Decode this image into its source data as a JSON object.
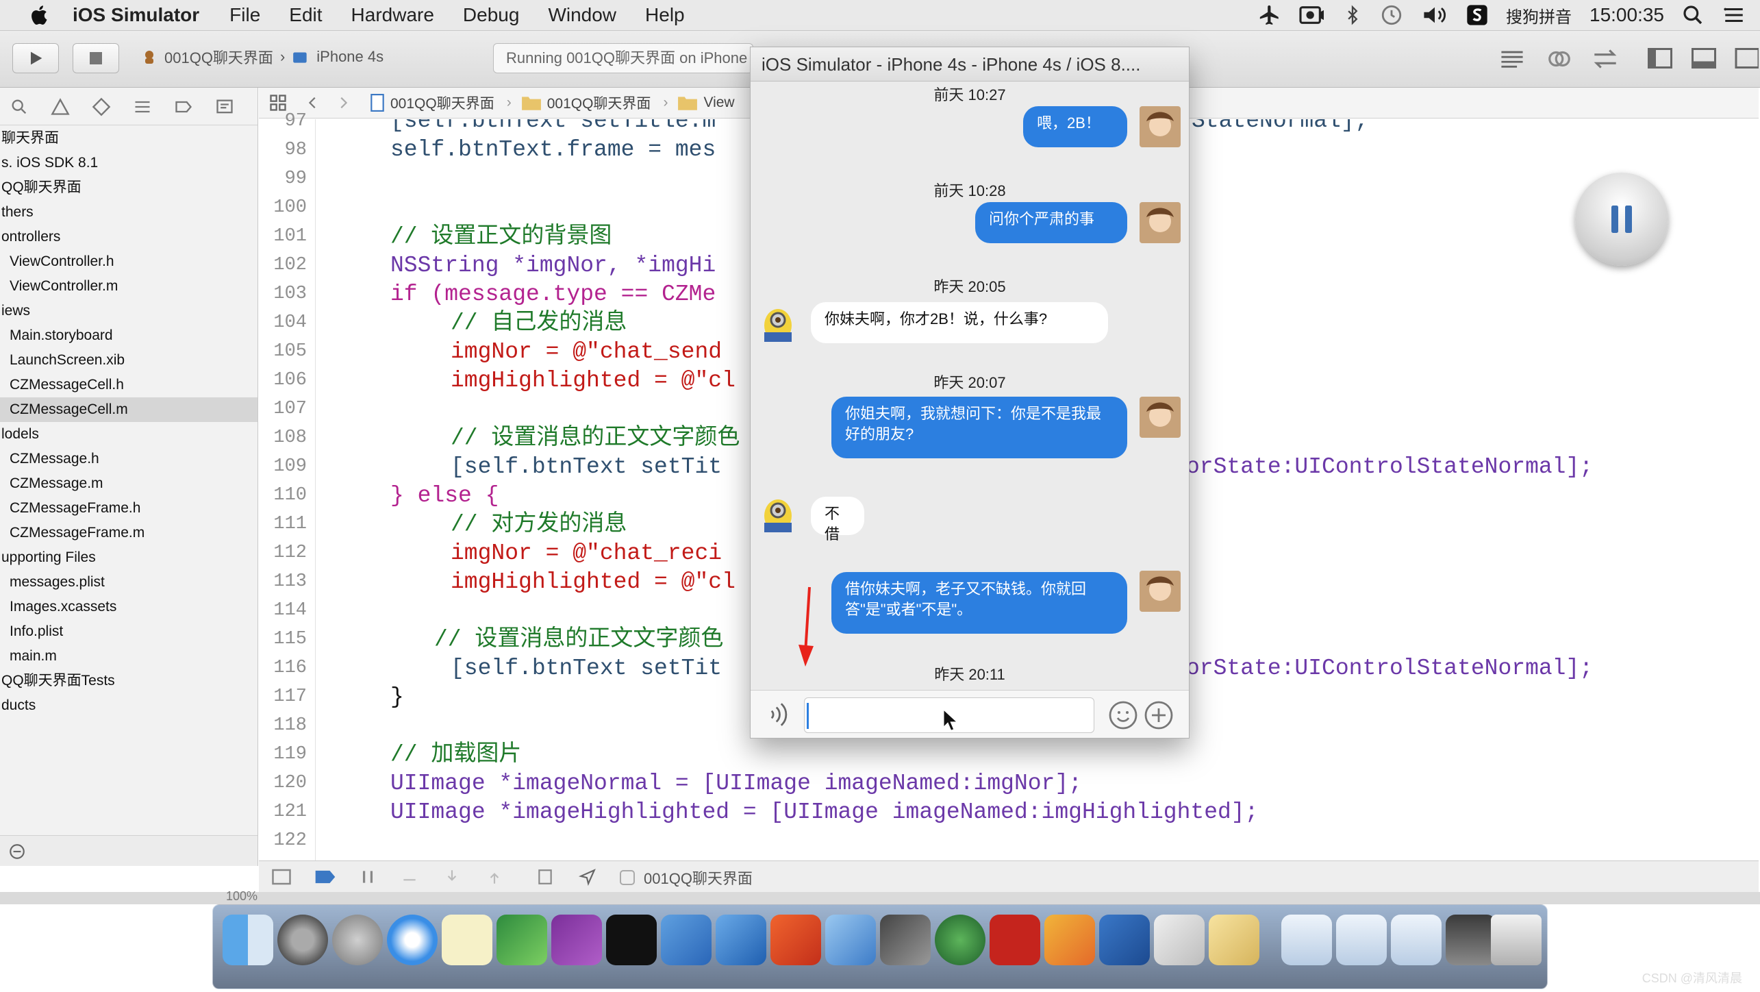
{
  "menubar": {
    "app_name": "iOS Simulator",
    "items": [
      "File",
      "Edit",
      "Hardware",
      "Debug",
      "Window",
      "Help"
    ],
    "ime_label": "搜狗拼音",
    "clock": "15:00:35"
  },
  "toolbar": {
    "scheme_project": "001QQ聊天界面",
    "scheme_device": "iPhone 4s",
    "status": "Running 001QQ聊天界面 on iPhone"
  },
  "jumpbar": {
    "crumbs": [
      "001QQ聊天界面",
      "001QQ聊天界面",
      "View"
    ]
  },
  "navigator": {
    "rows": [
      {
        "label": "聊天界面"
      },
      {
        "label": "s. iOS SDK 8.1"
      },
      {
        "label": "QQ聊天界面"
      },
      {
        "label": "thers"
      },
      {
        "label": "ontrollers"
      },
      {
        "label": "ViewController.h"
      },
      {
        "label": "ViewController.m"
      },
      {
        "label": "iews"
      },
      {
        "label": "Main.storyboard"
      },
      {
        "label": "LaunchScreen.xib"
      },
      {
        "label": "CZMessageCell.h"
      },
      {
        "label": "CZMessageCell.m",
        "selected": true
      },
      {
        "label": "lodels"
      },
      {
        "label": "CZMessage.h"
      },
      {
        "label": "CZMessage.m"
      },
      {
        "label": "CZMessageFrame.h"
      },
      {
        "label": "CZMessageFrame.m"
      },
      {
        "label": "upporting Files"
      },
      {
        "label": "messages.plist"
      },
      {
        "label": "Images.xcassets"
      },
      {
        "label": "Info.plist"
      },
      {
        "label": "main.m"
      },
      {
        "label": "QQ聊天界面Tests"
      },
      {
        "label": "ducts"
      }
    ]
  },
  "editor": {
    "line_numbers": [
      "97",
      "98",
      "99",
      "100",
      "101",
      "102",
      "103",
      "104",
      "105",
      "106",
      "107",
      "108",
      "109",
      "110",
      "111",
      "112",
      "113",
      "114",
      "115",
      "116",
      "117",
      "118",
      "119",
      "120",
      "121",
      "122"
    ],
    "code": {
      "l97a": "[self.btnText setTitle:m",
      "l97b": "StateNormal];",
      "l98": "self.btnText.frame = mes",
      "l101": "// 设置正文的背景图",
      "l102": "NSString *imgNor, *imgHi",
      "l103": "if (message.type == CZMe",
      "l104": "// 自己发的消息",
      "l105": "imgNor = @\"chat_send",
      "l106": "imgHighlighted = @\"cl",
      "l108": "// 设置消息的正文文字颜色",
      "l109a": "[self.btnText setTit",
      "l109b": "orState:UIControlStateNormal];",
      "l110": "} else {",
      "l111": "// 对方发的消息",
      "l112": "imgNor = @\"chat_reci",
      "l113": "imgHighlighted = @\"cl",
      "l115": "// 设置消息的正文文字颜色",
      "l116a": "[self.btnText setTit",
      "l116b": "orState:UIControlStateNormal];",
      "l117": "}",
      "l119": "// 加载图片",
      "l120": "UIImage *imageNormal = [UIImage imageNamed:imgNor];",
      "l121": "UIImage *imageHighlighted = [UIImage imageNamed:imgHighlighted];"
    }
  },
  "debugbar": {
    "target": "001QQ聊天界面"
  },
  "simulator": {
    "title": "iOS Simulator - iPhone 4s - iPhone 4s / iOS 8....",
    "messages": [
      {
        "time": "前天 10:27",
        "from": "me",
        "text": "喂，2B！"
      },
      {
        "time": "前天 10:28",
        "from": "me",
        "text": "问你个严肃的事"
      },
      {
        "time": "昨天 20:05",
        "from": "other",
        "text": "你妹夫啊，你才2B！说，什么事?"
      },
      {
        "time": "昨天 20:07",
        "from": "me",
        "text": "你姐夫啊，我就想问下：你是不是我最好的朋友?"
      },
      {
        "time": "",
        "from": "other",
        "text": "不借"
      },
      {
        "time": "",
        "from": "me",
        "text": "借你妹夫啊，老子又不缺钱。你就回答\"是\"或者\"不是\"。"
      },
      {
        "time": "昨天 20:11",
        "from": "",
        "text": ""
      }
    ],
    "input_value": ""
  },
  "watermark": "CSDN @清风清晨",
  "colors": {
    "bubble_me": "#2c7fe0",
    "bubble_other": "#ffffff",
    "keyword": "#b3228f",
    "comment": "#1f7a2a",
    "string": "#c21a17",
    "annotation_arrow": "#e8231b"
  }
}
